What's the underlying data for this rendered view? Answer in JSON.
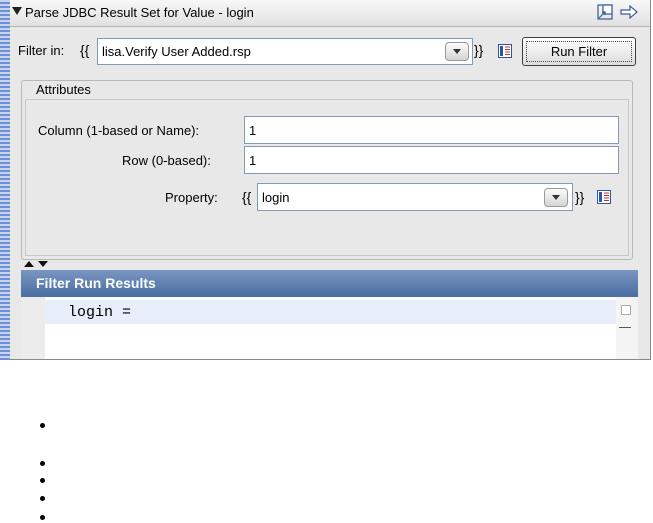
{
  "header": {
    "title": "Parse JDBC Result Set for Value - login"
  },
  "filter": {
    "label": "Filter in:",
    "open_brace": "{{",
    "close_brace": "}}",
    "value": "lisa.Verify User Added.rsp",
    "run_button_label": "Run Filter"
  },
  "attributes": {
    "title": "Attributes",
    "column_label": "Column (1-based or Name):",
    "column_value": "1",
    "row_label": "Row (0-based):",
    "row_value": "1",
    "property_label": "Property:",
    "property_open_brace": "{{",
    "property_close_brace": "}}",
    "property_value": "login"
  },
  "results": {
    "title": "Filter Run Results",
    "line": "login ="
  },
  "bullets_count": 5,
  "colors": {
    "results_header": "#4a6da2",
    "strip": "#6c8fd6",
    "highlight_line": "#e8eef9"
  }
}
